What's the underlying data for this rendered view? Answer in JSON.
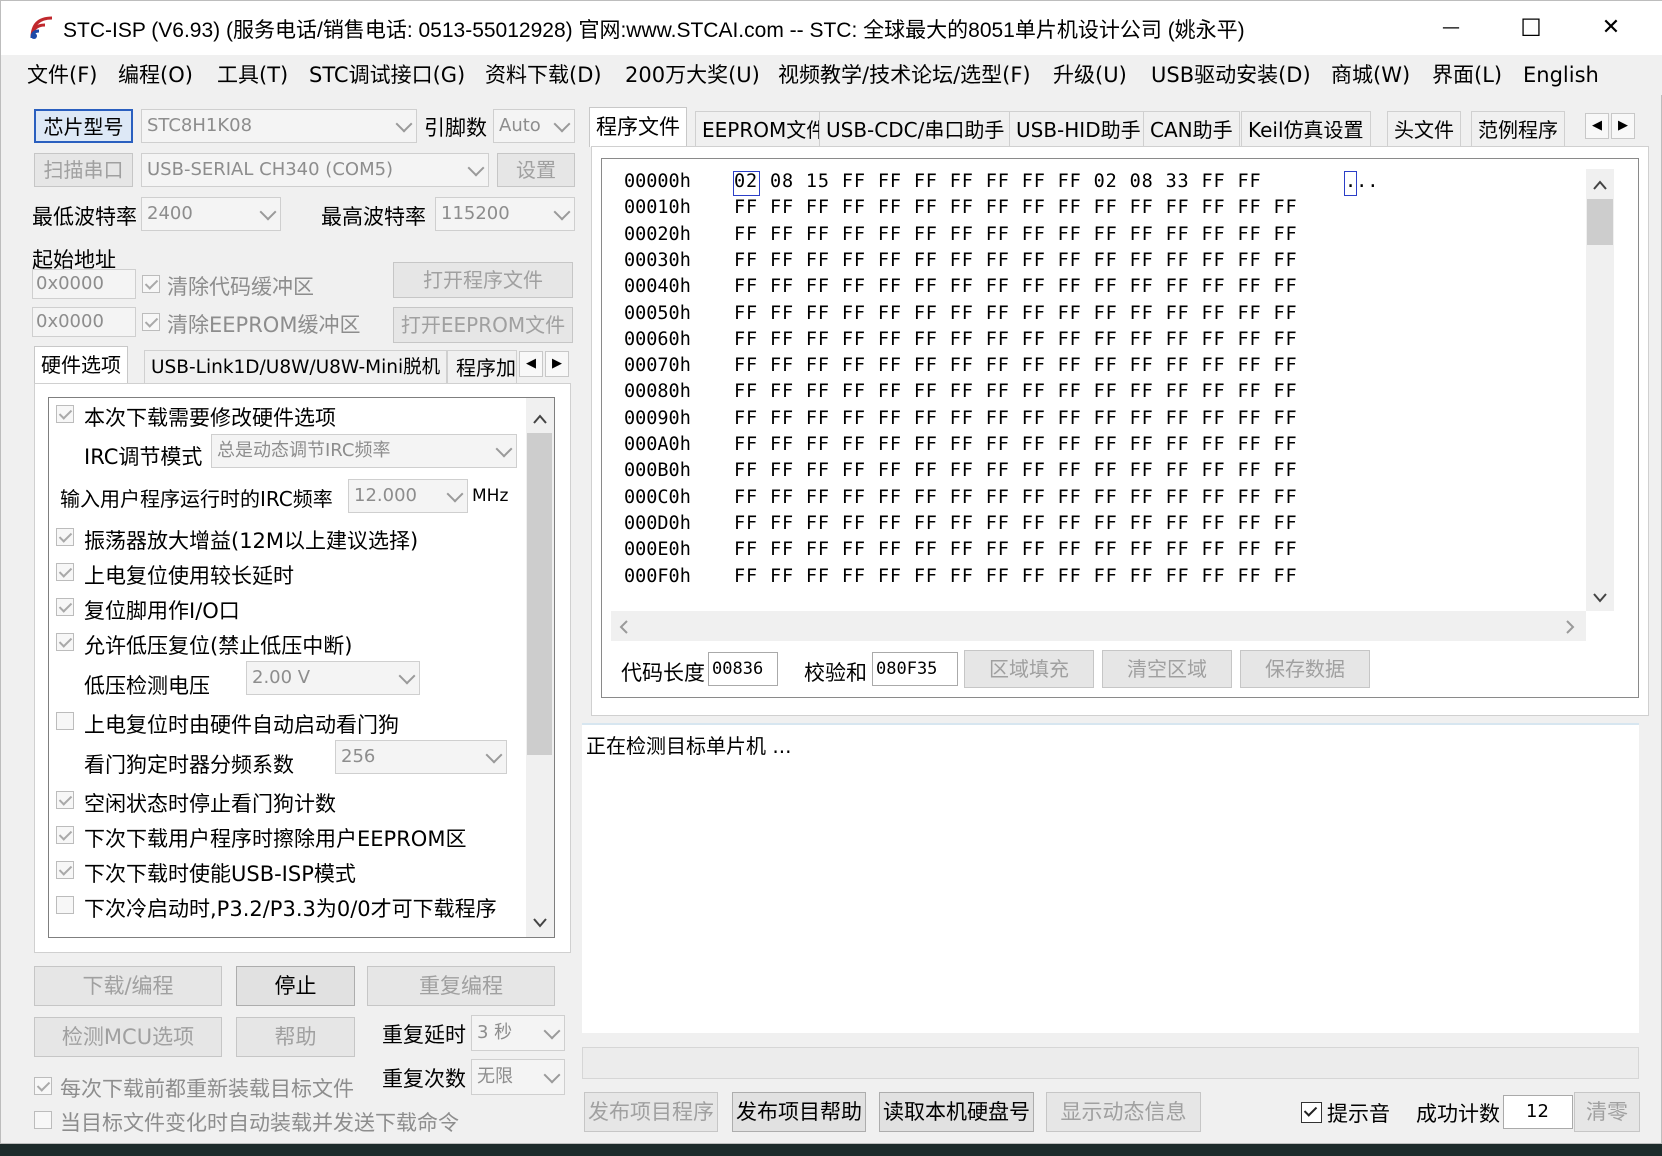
{
  "window": {
    "title": "STC-ISP (V6.93) (服务电话/销售电话: 0513-55012928) 官网:www.STCAI.com  -- STC: 全球最大的8051单片机设计公司 (姚永平)",
    "controls": {
      "minimize": "—",
      "maximize": "☐",
      "close": "✕"
    }
  },
  "menu": [
    "文件(F)",
    "编程(O)",
    "工具(T)",
    "STC调试接口(G)",
    "资料下载(D)",
    "200万大奖(U)",
    "视频教学/技术论坛/选型(F)",
    "升级(U)",
    "USB驱动安装(D)",
    "商城(W)",
    "界面(L)",
    "English"
  ],
  "left": {
    "chip_button": "芯片型号",
    "chip_value": "STC8H1K08",
    "pins_label": "引脚数",
    "pins_value": "Auto",
    "scan_button": "扫描串口",
    "port_value": "USB-SERIAL CH340 (COM5)",
    "settings_button": "设置",
    "min_baud_label": "最低波特率",
    "min_baud_value": "2400",
    "max_baud_label": "最高波特率",
    "max_baud_value": "115200",
    "start_addr_label": "起始地址",
    "addr1": "0x0000",
    "clear_code": "清除代码缓冲区",
    "open_program": "打开程序文件",
    "addr2": "0x0000",
    "clear_eeprom": "清除EEPROM缓冲区",
    "open_eeprom": "打开EEPROM文件",
    "tabs": [
      "硬件选项",
      "USB-Link1D/U8W/U8W-Mini脱机",
      "程序加"
    ],
    "options": {
      "opt1": "本次下载需要修改硬件选项",
      "irc_mode_label": "IRC调节模式",
      "irc_mode_value": "总是动态调节IRC频率",
      "irc_freq_label": "输入用户程序运行时的IRC频率",
      "irc_freq_value": "12.000",
      "irc_freq_unit": "MHz",
      "opt2": "振荡器放大增益(12M以上建议选择)",
      "opt3": "上电复位使用较长延时",
      "opt4": "复位脚用作I/O口",
      "opt5": "允许低压复位(禁止低压中断)",
      "lvd_label": "低压检测电压",
      "lvd_value": "2.00 V",
      "opt6": "上电复位时由硬件自动启动看门狗",
      "wdt_label": "看门狗定时器分频系数",
      "wdt_value": "256",
      "opt7": "空闲状态时停止看门狗计数",
      "opt8": "下次下载用户程序时擦除用户EEPROM区",
      "opt9": "下次下载时使能USB-ISP模式",
      "opt10": "下次冷启动时,P3.2/P3.3为0/0才可下载程序"
    },
    "download_button": "下载/编程",
    "stop_button": "停止",
    "reprogram_button": "重复编程",
    "check_mcu_button": "检测MCU选项",
    "help_button": "帮助",
    "repeat_delay_label": "重复延时",
    "repeat_delay_value": "3 秒",
    "repeat_count_label": "重复次数",
    "repeat_count_value": "无限",
    "reload_before": "每次下载前都重新装载目标文件",
    "auto_load": "当目标文件变化时自动装载并发送下载命令"
  },
  "right": {
    "tabs": [
      "程序文件",
      "EEPROM文件",
      "USB-CDC/串口助手",
      "USB-HID助手",
      "CAN助手",
      "Keil仿真设置",
      "头文件",
      "范例程序"
    ],
    "hex_rows": [
      {
        "addr": "00000h",
        "bytes": "02 08 15 FF FF FF FF FF FF FF 02 08 33 FF FF",
        "ascii": "..."
      },
      {
        "addr": "00010h",
        "bytes": "FF FF FF FF FF FF FF FF FF FF FF FF FF FF FF FF"
      },
      {
        "addr": "00020h",
        "bytes": "FF FF FF FF FF FF FF FF FF FF FF FF FF FF FF FF"
      },
      {
        "addr": "00030h",
        "bytes": "FF FF FF FF FF FF FF FF FF FF FF FF FF FF FF FF"
      },
      {
        "addr": "00040h",
        "bytes": "FF FF FF FF FF FF FF FF FF FF FF FF FF FF FF FF"
      },
      {
        "addr": "00050h",
        "bytes": "FF FF FF FF FF FF FF FF FF FF FF FF FF FF FF FF"
      },
      {
        "addr": "00060h",
        "bytes": "FF FF FF FF FF FF FF FF FF FF FF FF FF FF FF FF"
      },
      {
        "addr": "00070h",
        "bytes": "FF FF FF FF FF FF FF FF FF FF FF FF FF FF FF FF"
      },
      {
        "addr": "00080h",
        "bytes": "FF FF FF FF FF FF FF FF FF FF FF FF FF FF FF FF"
      },
      {
        "addr": "00090h",
        "bytes": "FF FF FF FF FF FF FF FF FF FF FF FF FF FF FF FF"
      },
      {
        "addr": "000A0h",
        "bytes": "FF FF FF FF FF FF FF FF FF FF FF FF FF FF FF FF"
      },
      {
        "addr": "000B0h",
        "bytes": "FF FF FF FF FF FF FF FF FF FF FF FF FF FF FF FF"
      },
      {
        "addr": "000C0h",
        "bytes": "FF FF FF FF FF FF FF FF FF FF FF FF FF FF FF FF"
      },
      {
        "addr": "000D0h",
        "bytes": "FF FF FF FF FF FF FF FF FF FF FF FF FF FF FF FF"
      },
      {
        "addr": "000E0h",
        "bytes": "FF FF FF FF FF FF FF FF FF FF FF FF FF FF FF FF"
      },
      {
        "addr": "000F0h",
        "bytes": "FF FF FF FF FF FF FF FF FF FF FF FF FF FF FF FF"
      }
    ],
    "code_len_label": "代码长度",
    "code_len_value": "00836",
    "checksum_label": "校验和",
    "checksum_value": "080F35",
    "fill_button": "区域填充",
    "clear_button": "清空区域",
    "save_button": "保存数据",
    "log_text": "正在检测目标单片机 ...",
    "publish_program": "发布项目程序",
    "publish_help": "发布项目帮助",
    "read_disk": "读取本机硬盘号",
    "show_dynamic": "显示动态信息",
    "sound_label": "提示音",
    "success_label": "成功计数",
    "success_value": "12",
    "reset_button": "清零"
  }
}
